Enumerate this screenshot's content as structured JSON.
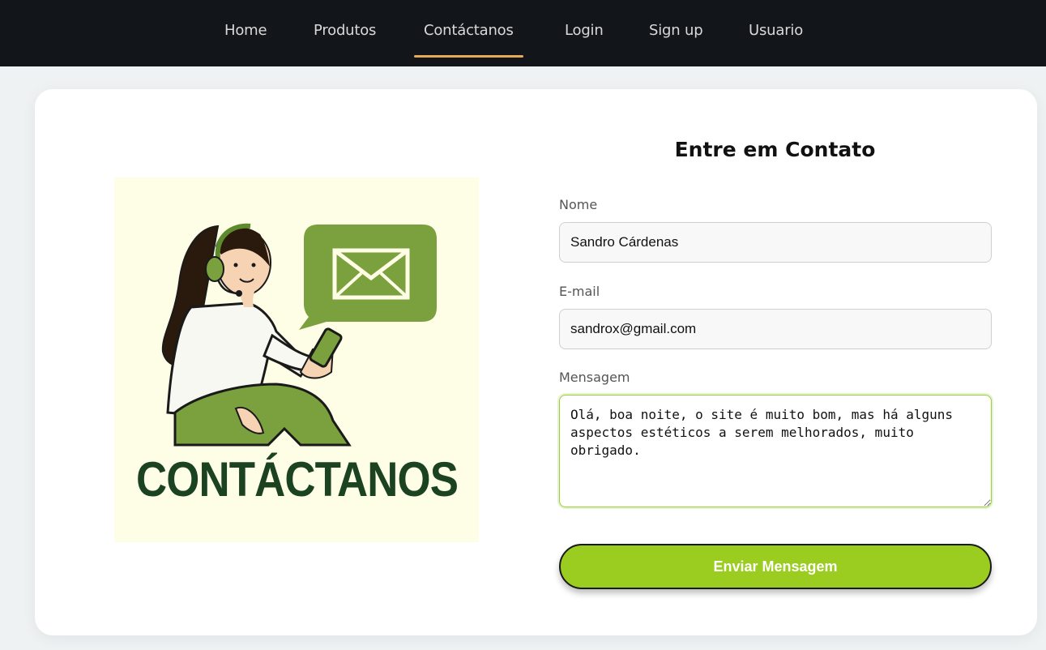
{
  "nav": {
    "items": [
      {
        "label": "Home",
        "active": false
      },
      {
        "label": "Produtos",
        "active": false
      },
      {
        "label": "Contáctanos",
        "active": true
      },
      {
        "label": "Login",
        "active": false
      },
      {
        "label": "Sign up",
        "active": false
      },
      {
        "label": "Usuario",
        "active": false
      }
    ]
  },
  "illustration": {
    "caption": "CONTÁCTANOS",
    "icons": [
      "headset-icon",
      "mail-envelope-icon",
      "phone-icon"
    ]
  },
  "form": {
    "title": "Entre em Contato",
    "name_label": "Nome",
    "name_value": "Sandro Cárdenas",
    "email_label": "E-mail",
    "email_value": "sandrox@gmail.com",
    "message_label": "Mensagem",
    "message_value": "Olá, boa noite, o site é muito bom, mas há alguns aspectos estéticos a serem melhorados, muito obrigado.",
    "submit_label": "Enviar Mensagem"
  },
  "colors": {
    "navbar_bg": "#121519",
    "nav_active_underline": "#e4a95b",
    "button_green": "#9acd1f",
    "illustration_bg": "#fefde6",
    "caption_green": "#1b4221"
  }
}
